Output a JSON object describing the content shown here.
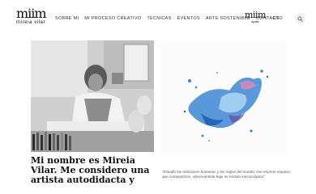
{
  "header": {
    "logo_mark": "miim",
    "logo_subtitle": "mireia vilar",
    "nav": [
      {
        "label": "SOBRE MI"
      },
      {
        "label": "MI PROCESO CREATIVO"
      },
      {
        "label": "TÉCNICAS"
      },
      {
        "label": "EVENTOS"
      },
      {
        "label": "ARTE SOSTENIBLE"
      },
      {
        "label": "CONTACTO"
      }
    ],
    "shop_mark": "miim",
    "shop_subtitle": "spain",
    "language": "ES",
    "search_icon": "search-icon"
  },
  "main": {
    "headline": "Mi nombre es Mireia Vilar. Me considero una artista autodidacta y",
    "quote": "\"Estudio las relaciones humanas y las reglas del mundo: ese enorme espacio que compartimos, observándolo bajo mi mirada microscópica\""
  },
  "colors": {
    "accent_blue": "#2f6fc0",
    "ink": "#111111",
    "background": "#ffffff"
  }
}
